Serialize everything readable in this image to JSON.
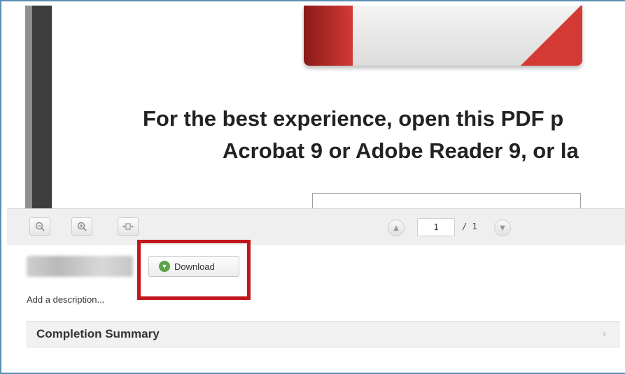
{
  "pdf": {
    "line1": "For the best experience, open this PDF p",
    "line2": "Acrobat 9 or Adobe Reader 9, or la"
  },
  "toolbar": {
    "zoom_out_icon": "zoom-out-icon",
    "zoom_in_icon": "zoom-in-icon",
    "fit_width_icon": "fit-width-icon",
    "page_current": "1",
    "page_total": "/ 1",
    "prev_icon": "triangle-up-icon",
    "next_icon": "triangle-down-icon"
  },
  "file": {
    "download_label": "Download",
    "add_description": "Add a description..."
  },
  "completion": {
    "title": "Completion Summary"
  },
  "colors": {
    "highlight": "#c0171d",
    "download_icon": "#5aa44a",
    "frame": "#5a8fb0"
  }
}
